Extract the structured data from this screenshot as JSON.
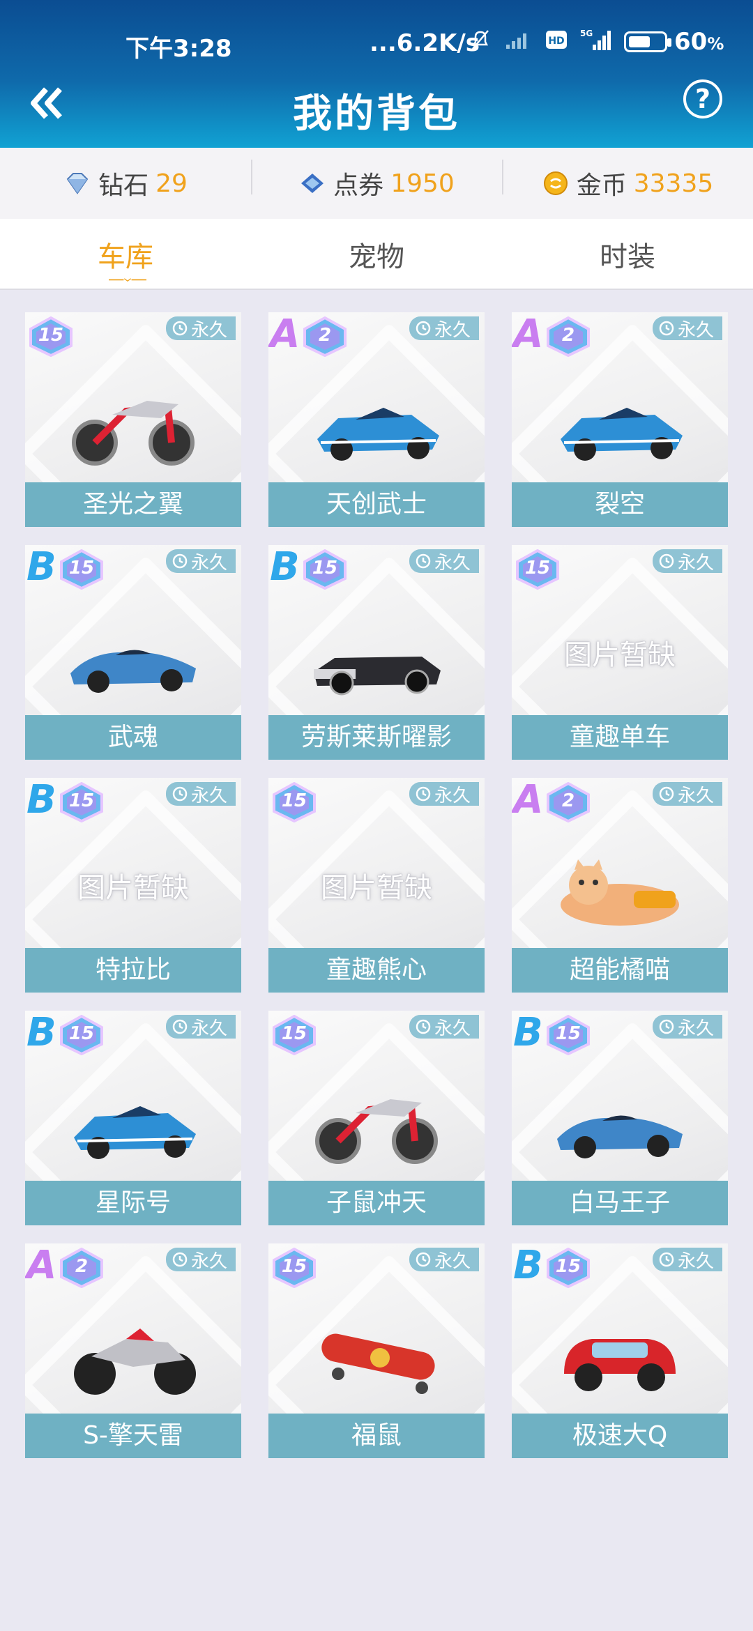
{
  "status": {
    "time": "下午3:28",
    "speed": "...6.2K/s",
    "battery_text": "60",
    "battery_unit": "%",
    "battery_level": 0.6
  },
  "header": {
    "title": "我的背包",
    "help_label": "?"
  },
  "currency": [
    {
      "label": "钻石",
      "value": "29",
      "icon": "diamond-icon"
    },
    {
      "label": "点券",
      "value": "1950",
      "icon": "coupon-icon"
    },
    {
      "label": "金币",
      "value": "33335",
      "icon": "coin-icon"
    }
  ],
  "tabs": [
    {
      "label": "车库",
      "active": true
    },
    {
      "label": "宠物",
      "active": false
    },
    {
      "label": "时装",
      "active": false
    }
  ],
  "items": [
    {
      "name": "圣光之翼",
      "grade": "",
      "level": "15",
      "duration": "永久",
      "image": "motorbike"
    },
    {
      "name": "天创武士",
      "grade": "A",
      "level": "2",
      "duration": "永久",
      "image": "racecar"
    },
    {
      "name": "裂空",
      "grade": "A",
      "level": "2",
      "duration": "永久",
      "image": "racecar"
    },
    {
      "name": "武魂",
      "grade": "B",
      "level": "15",
      "duration": "永久",
      "image": "sportscar"
    },
    {
      "name": "劳斯莱斯曜影",
      "grade": "B",
      "level": "15",
      "duration": "永久",
      "image": "convertible"
    },
    {
      "name": "童趣单车",
      "grade": "",
      "level": "15",
      "duration": "永久",
      "image": "missing"
    },
    {
      "name": "特拉比",
      "grade": "B",
      "level": "15",
      "duration": "永久",
      "image": "missing"
    },
    {
      "name": "童趣熊心",
      "grade": "",
      "level": "15",
      "duration": "永久",
      "image": "missing"
    },
    {
      "name": "超能橘喵",
      "grade": "A",
      "level": "2",
      "duration": "永久",
      "image": "cat-kart"
    },
    {
      "name": "星际号",
      "grade": "B",
      "level": "15",
      "duration": "永久",
      "image": "racecar"
    },
    {
      "name": "子鼠冲天",
      "grade": "",
      "level": "15",
      "duration": "永久",
      "image": "motorbike"
    },
    {
      "name": "白马王子",
      "grade": "B",
      "level": "15",
      "duration": "永久",
      "image": "sportscar"
    },
    {
      "name": "S-擎天雷",
      "grade": "A",
      "level": "2",
      "duration": "永久",
      "image": "atv"
    },
    {
      "name": "福鼠",
      "grade": "",
      "level": "15",
      "duration": "永久",
      "image": "skateboard"
    },
    {
      "name": "极速大Q",
      "grade": "B",
      "level": "15",
      "duration": "永久",
      "image": "minicar"
    }
  ],
  "missing_image_text": "图片暂缺",
  "colors": {
    "accent": "#f0a21c",
    "card_label_bg": "#6fb1c3",
    "grade_A": "#c97ef0",
    "grade_B": "#2fa7ea"
  }
}
